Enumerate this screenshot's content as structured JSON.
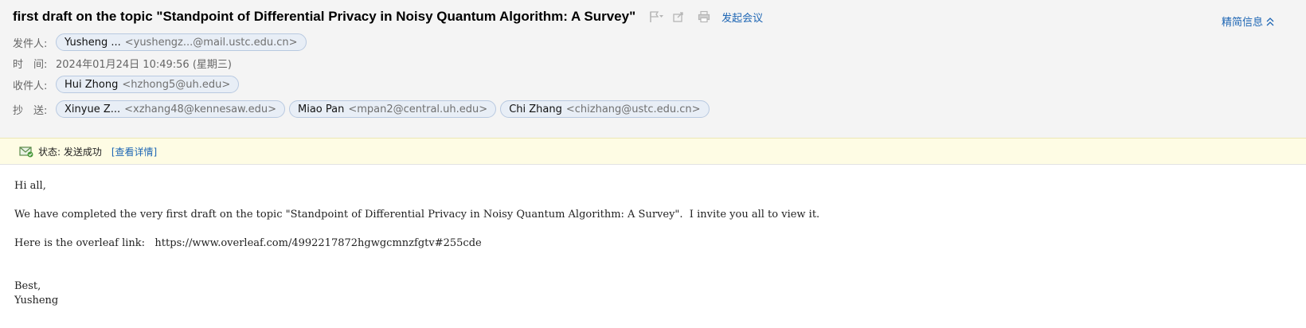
{
  "email": {
    "subject": "first draft on the topic \"Standpoint of Differential Privacy in Noisy Quantum Algorithm: A Survey\"",
    "meeting_link": "发起会议",
    "brief_info_link": "精简信息",
    "icons": {
      "flag": "flag-icon",
      "share": "share-icon",
      "print": "print-icon",
      "collapse": "chevrons-up-icon",
      "status": "mail-sent-icon"
    },
    "from": {
      "label": "发件人:",
      "name": "Yusheng ...",
      "email": "<yushengz...@mail.ustc.edu.cn>"
    },
    "time": {
      "label": "时　间:",
      "value": "2024年01月24日 10:49:56 (星期三)"
    },
    "to": {
      "label": "收件人:",
      "recipients": [
        {
          "name": "Hui Zhong",
          "email": "<hzhong5@uh.edu>"
        }
      ]
    },
    "cc": {
      "label": "抄　送:",
      "recipients": [
        {
          "name": "Xinyue Z...",
          "email": "<xzhang48@kennesaw.edu>"
        },
        {
          "name": "Miao Pan",
          "email": "<mpan2@central.uh.edu>"
        },
        {
          "name": "Chi Zhang",
          "email": "<chizhang@ustc.edu.cn>"
        }
      ]
    },
    "status": {
      "text": "状态: 发送成功",
      "details_link": "[查看详情]"
    },
    "body": {
      "greeting": "Hi all,",
      "line1": "We have completed the very first draft on the topic \"Standpoint of Differential Privacy in Noisy Quantum Algorithm: A Survey\".  I invite you all to view it.",
      "line2": "Here is the overleaf link:   https://www.overleaf.com/4992217872hgwgcmnzfgtv#255cde",
      "signoff": "Best,",
      "signature": "Yusheng"
    }
  },
  "colors": {
    "link": "#1e66b4",
    "header_bg": "#f4f4f4",
    "status_bg": "#fefce4",
    "chip_bg": "#e8eef6",
    "chip_border": "#b8c9e0"
  }
}
